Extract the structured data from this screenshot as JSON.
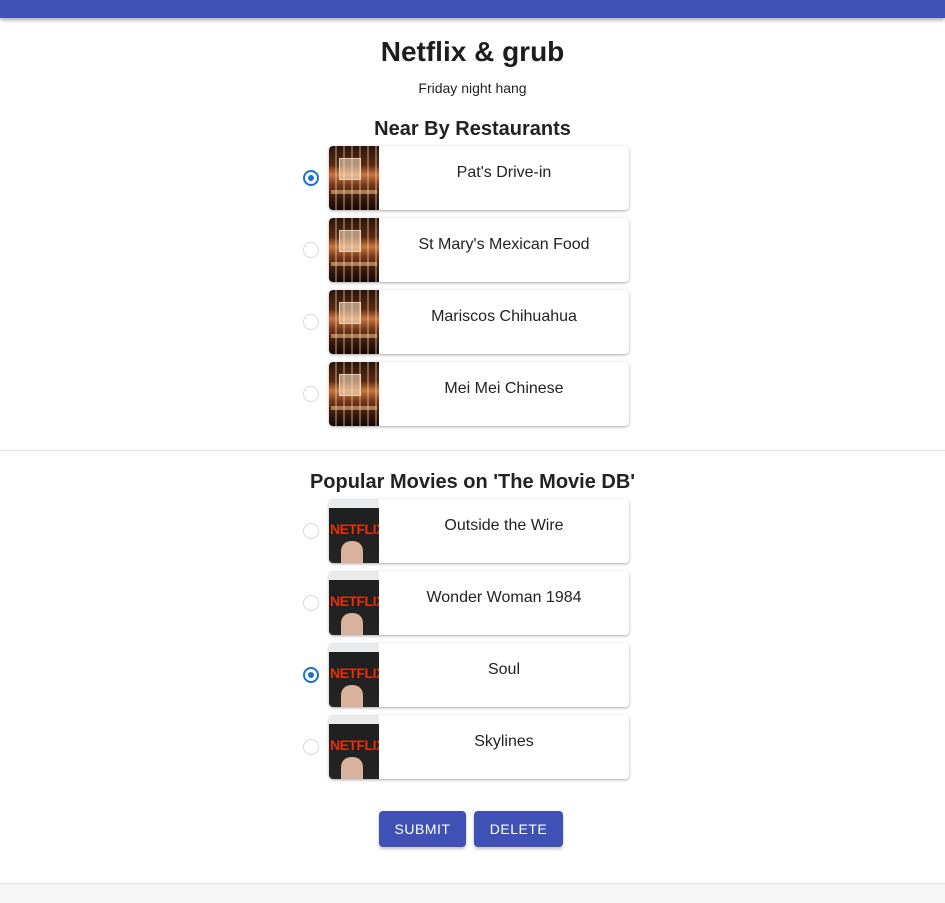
{
  "header": {
    "bar_color": "#3f51b5"
  },
  "event": {
    "title": "Netflix & grub",
    "subtitle": "Friday night hang"
  },
  "restaurants": {
    "title": "Near By Restaurants",
    "items": [
      {
        "label": "Pat's Drive-in",
        "selected": true,
        "thumbnail": "restaurant-photo"
      },
      {
        "label": "St Mary's Mexican Food",
        "selected": false,
        "thumbnail": "restaurant-photo"
      },
      {
        "label": "Mariscos Chihuahua",
        "selected": false,
        "thumbnail": "restaurant-photo"
      },
      {
        "label": "Mei Mei Chinese",
        "selected": false,
        "thumbnail": "restaurant-photo"
      }
    ]
  },
  "movies": {
    "title": "Popular Movies on 'The Movie DB'",
    "items": [
      {
        "label": "Outside the Wire",
        "selected": false,
        "thumbnail": "netflix-photo"
      },
      {
        "label": "Wonder Woman 1984",
        "selected": false,
        "thumbnail": "netflix-photo"
      },
      {
        "label": "Soul",
        "selected": true,
        "thumbnail": "netflix-photo"
      },
      {
        "label": "Skylines",
        "selected": false,
        "thumbnail": "netflix-photo"
      }
    ]
  },
  "thumbnail_text": {
    "netflix_logo": "NETFLIX"
  },
  "actions": {
    "submit_label": "SUBMIT",
    "delete_label": "DELETE"
  },
  "colors": {
    "primary": "#3f51b5",
    "radio_selected": "#1a73c8"
  }
}
